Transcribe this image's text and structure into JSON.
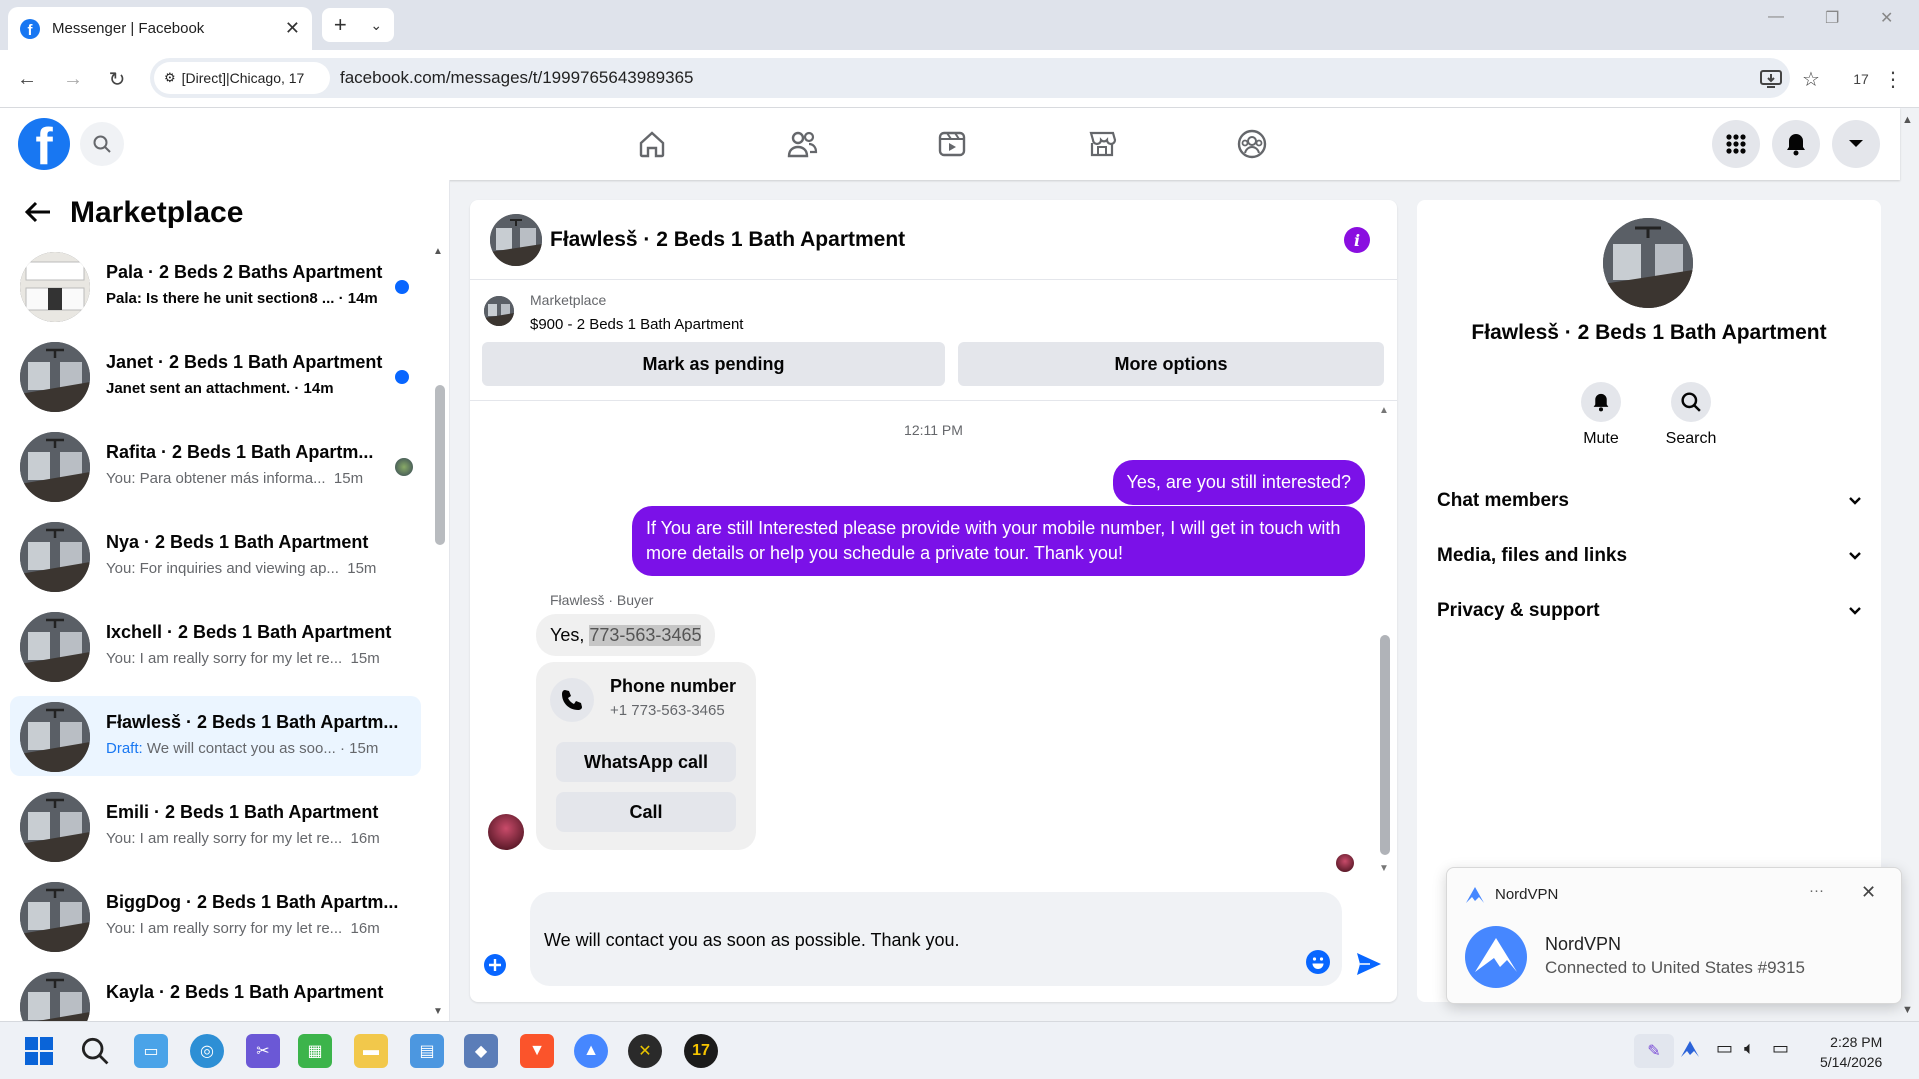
{
  "browser": {
    "tab_title": "Messenger | Facebook",
    "site_chip": "[Direct]|Chicago, 17",
    "url": "facebook.com/messages/t/1999765643989365",
    "ext_badge": "17"
  },
  "sidebar": {
    "title": "Marketplace",
    "conversations": [
      {
        "name": "Pala · 2 Beds 2 Baths Apartment",
        "snippet": "Pala: Is there he unit section8 ... · 14m",
        "unread": true
      },
      {
        "name": "Janet · 2 Beds 1 Bath Apartment",
        "snippet": "Janet sent an attachment. · 14m",
        "unread": true
      },
      {
        "name": "Rafita · 2 Beds 1 Bath Apartm...",
        "snippet": "You: Para obtener más informa...  15m",
        "unread": false
      },
      {
        "name": "Nya · 2 Beds 1 Bath Apartment",
        "snippet": "You: For inquiries and viewing ap...  15m",
        "unread": false
      },
      {
        "name": "Ixchell · 2 Beds 1 Bath Apartment",
        "snippet": "You: I am really sorry for my let re...  15m",
        "unread": false
      },
      {
        "name": "Fławlesš · 2 Beds 1 Bath Apartm...",
        "draft_label": "Draft:",
        "snippet": " We will contact you as soo... · 15m",
        "active": true
      },
      {
        "name": "Emili · 2 Beds 1 Bath Apartment",
        "snippet": "You: I am really sorry for my let re...  16m",
        "unread": false
      },
      {
        "name": "BiggDog · 2 Beds 1 Bath Apartm...",
        "snippet": "You: I am really sorry for my let re...  16m",
        "unread": false
      },
      {
        "name": "Kayla · 2 Beds 1 Bath Apartment",
        "snippet": "",
        "unread": false
      }
    ]
  },
  "chat": {
    "title": "Fławlesš · 2 Beds 1 Bath Apartment",
    "marketplace_label": "Marketplace",
    "listing": "$900 - 2 Beds 1 Bath Apartment",
    "mark_pending": "Mark as pending",
    "more_options": "More options",
    "timestamp": "12:11 PM",
    "out_msg_1": "Yes, are you still interested?",
    "out_msg_2": "If You are still Interested please provide with your mobile number, I will get in touch with more details or help you schedule a private tour. Thank you!",
    "sender_label": "Fławlesš · Buyer",
    "in_msg_prefix": "Yes, ",
    "in_msg_phone": "773-563-3465",
    "card_title": "Phone number",
    "card_number": "+1 773-563-3465",
    "whatsapp_call": "WhatsApp call",
    "call": "Call",
    "composer_text": "We will contact you as soon as possible. Thank you."
  },
  "info_panel": {
    "name": "Fławlesš · 2 Beds 1 Bath Apartment",
    "mute": "Mute",
    "search": "Search",
    "sections": [
      "Chat members",
      "Media, files and links",
      "Privacy & support"
    ]
  },
  "toast": {
    "app": "NordVPN",
    "more": "···",
    "title": "NordVPN",
    "body": "Connected to United States #9315"
  },
  "taskbar": {
    "time": "2:28 PM",
    "date": "5/14/2026"
  },
  "colors": {
    "facebook_blue": "#1877f2",
    "message_purple": "#7b11e8",
    "unread_dot": "#0866ff"
  }
}
